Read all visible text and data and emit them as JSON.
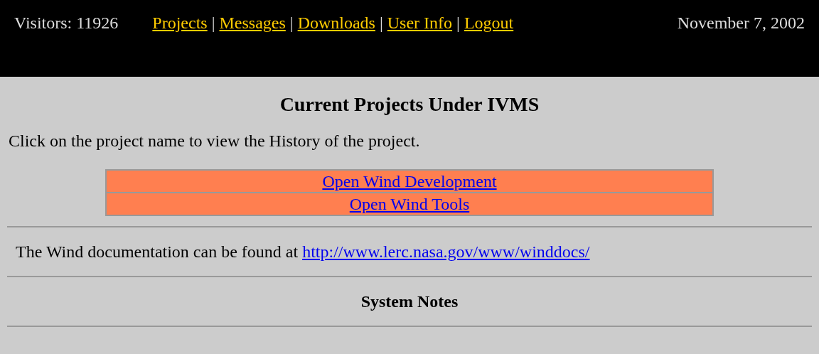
{
  "header": {
    "visitors": "Visitors: 11926",
    "nav": [
      {
        "label": "Projects"
      },
      {
        "label": "Messages"
      },
      {
        "label": "Downloads"
      },
      {
        "label": "User Info"
      },
      {
        "label": "Logout"
      }
    ],
    "separator": "|",
    "date": "November 7, 2002"
  },
  "title": "Current Projects Under IVMS",
  "intro": "Click on the project name to view the History of the project.",
  "projects": [
    {
      "name": "Open Wind Development"
    },
    {
      "name": "Open Wind Tools"
    }
  ],
  "docs": {
    "text": "The Wind documentation can be found at",
    "link": "http://www.lerc.nasa.gov/www/winddocs/"
  },
  "notes_title": "System Notes"
}
